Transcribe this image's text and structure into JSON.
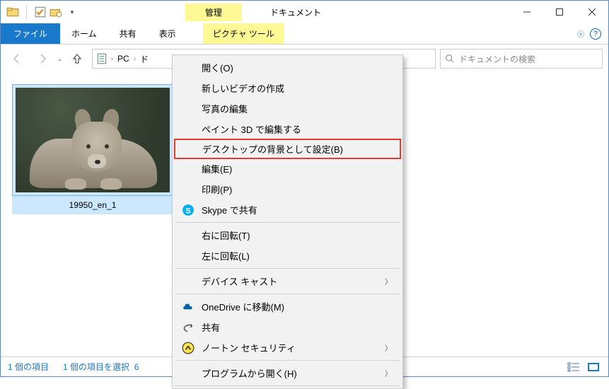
{
  "titlebar": {
    "manage_tab": "管理",
    "title": "ドキュメント"
  },
  "ribbon": {
    "file": "ファイル",
    "home": "ホーム",
    "share": "共有",
    "view": "表示",
    "picture_tools": "ピクチャ ツール"
  },
  "nav": {
    "breadcrumb": {
      "root": "PC",
      "seg1": "ド"
    },
    "search_placeholder": "ドキュメントの検索"
  },
  "file": {
    "name": "19950_en_1"
  },
  "ctx": {
    "open": "開く(O)",
    "new_video": "新しいビデオの作成",
    "edit_photo": "写真の編集",
    "paint3d": "ペイント 3D で編集する",
    "set_desktop": "デスクトップの背景として設定(B)",
    "edit": "編集(E)",
    "print": "印刷(P)",
    "skype": "Skype で共有",
    "rotate_r": "右に回転(T)",
    "rotate_l": "左に回転(L)",
    "cast": "デバイス キャスト",
    "onedrive": "OneDrive に移動(M)",
    "share": "共有",
    "norton": "ノートン セキュリティ",
    "open_with": "プログラムから開く(H)"
  },
  "status": {
    "items": "1 個の項目",
    "selected": "1 個の項目を選択",
    "size_prefix": "6"
  }
}
